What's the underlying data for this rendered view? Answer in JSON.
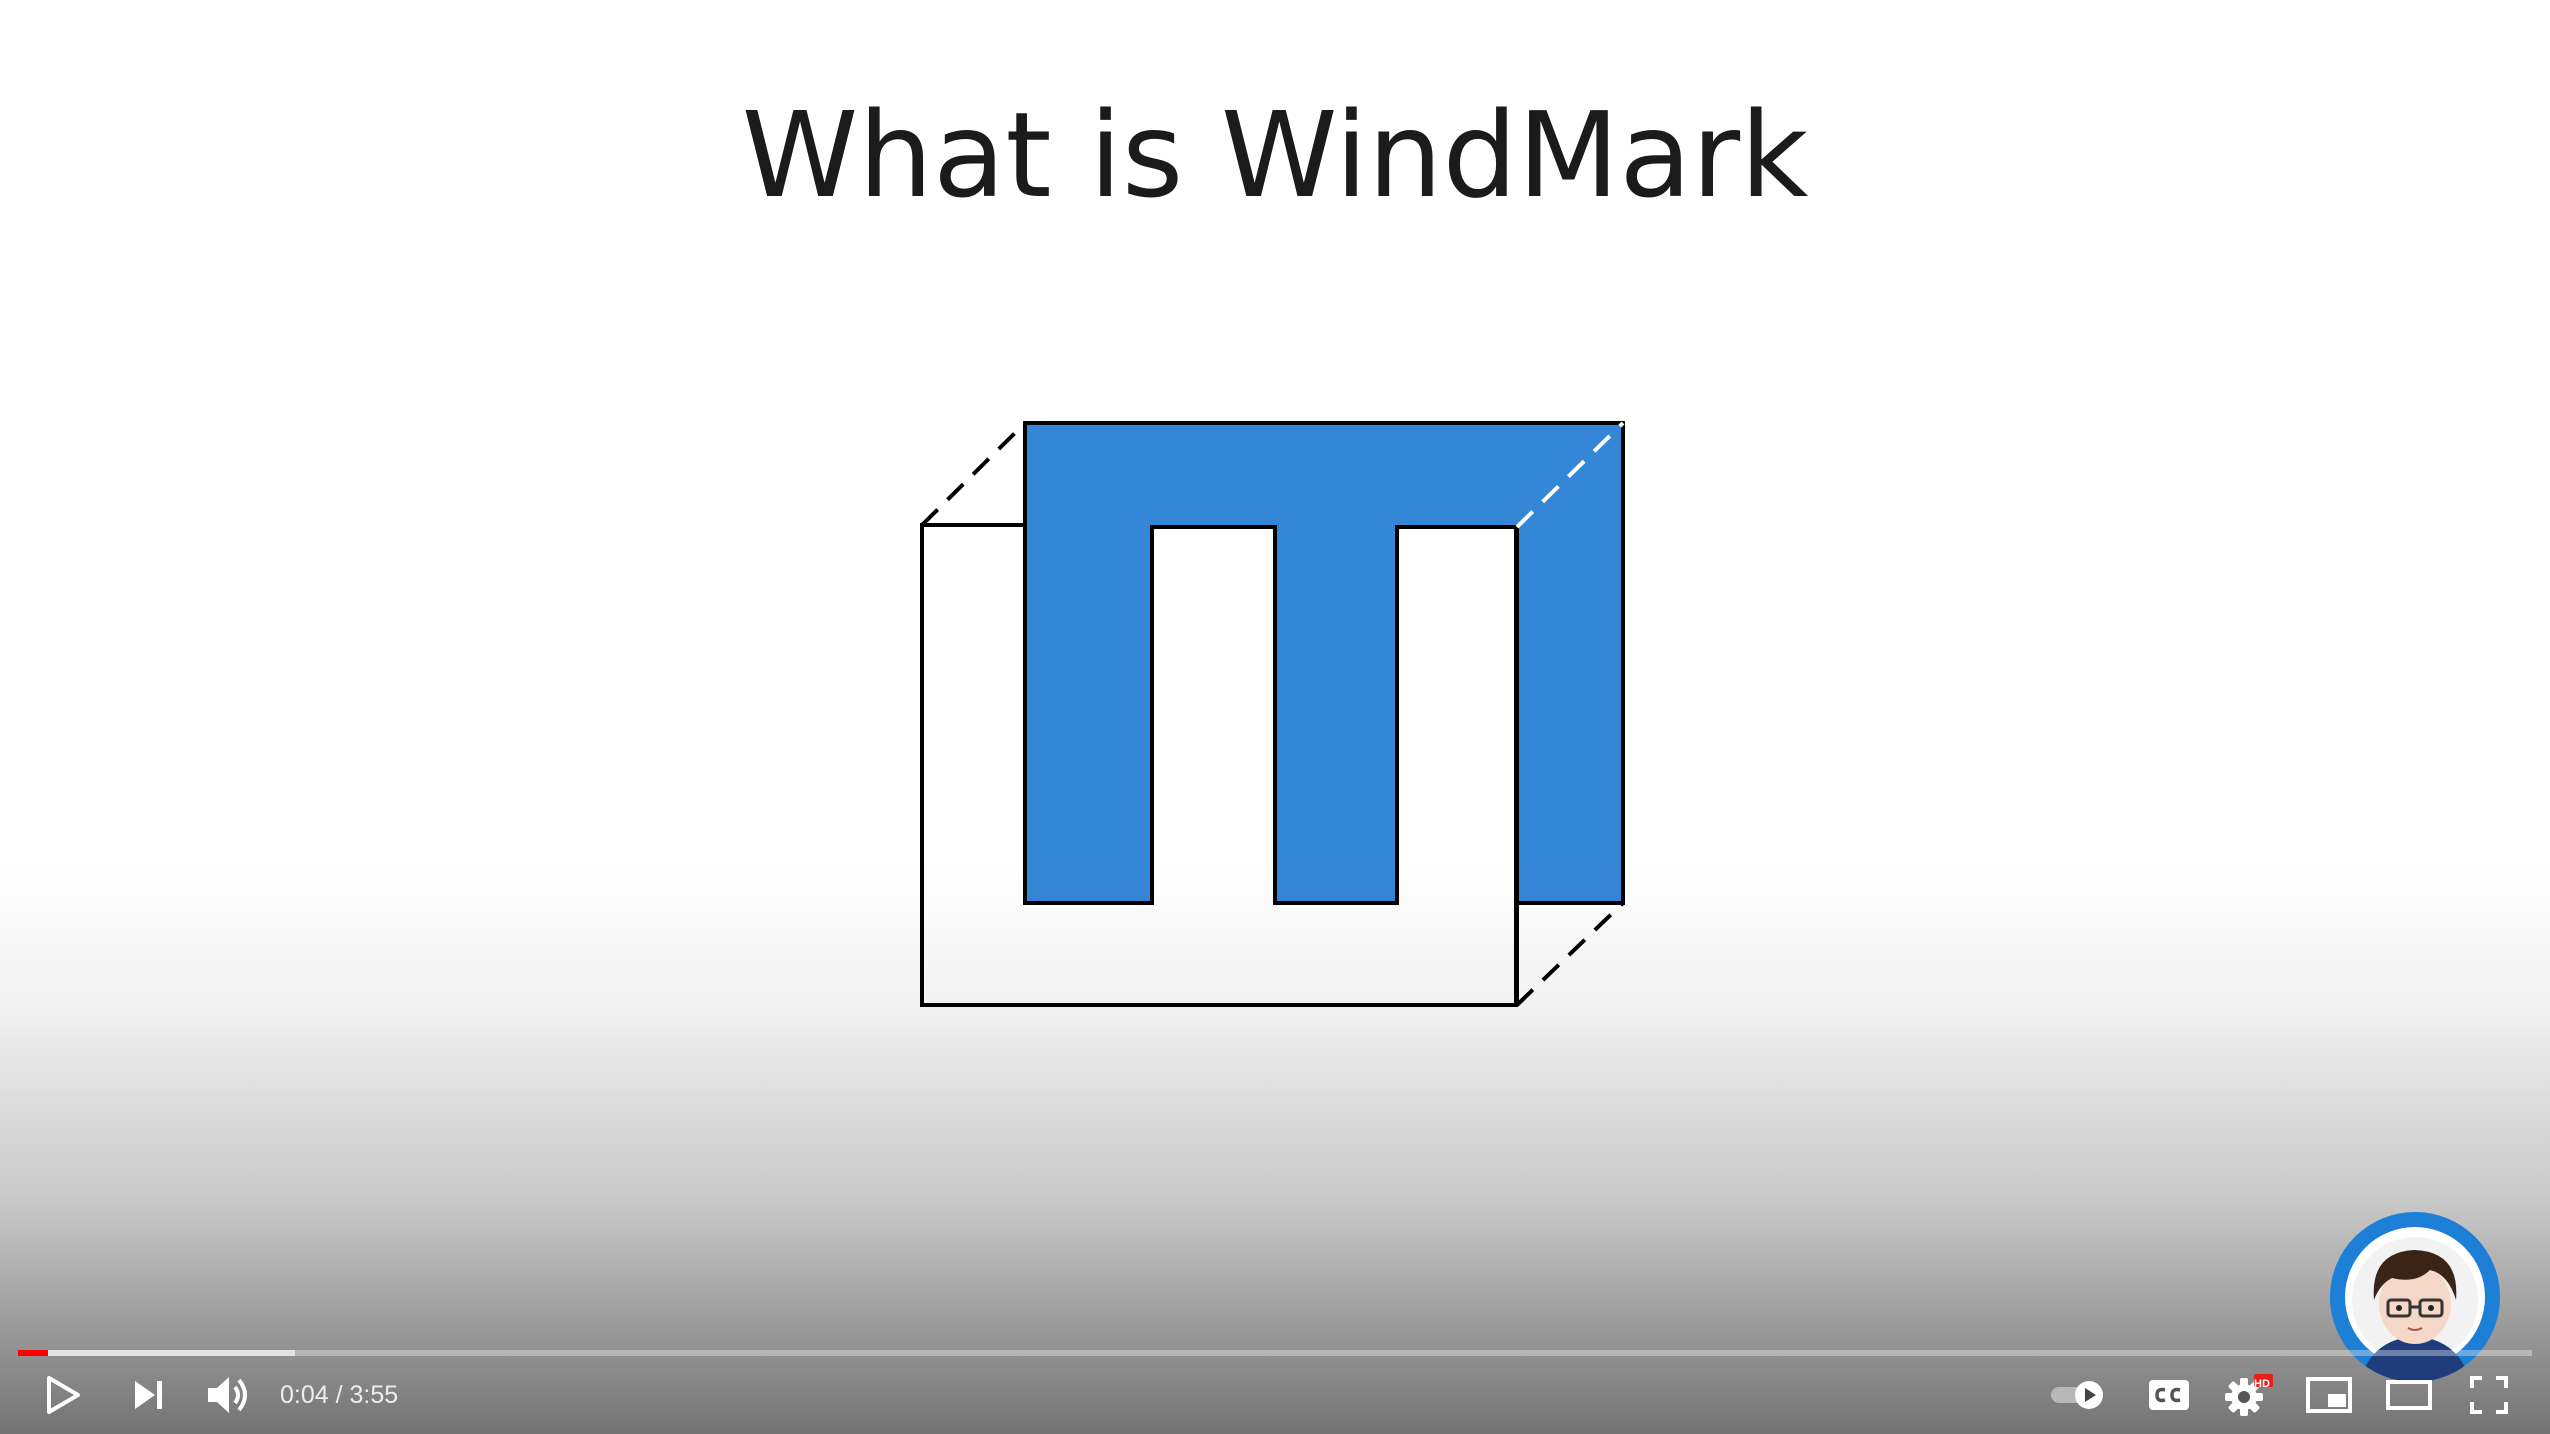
{
  "slide": {
    "title": "What is WindMark",
    "logo_colors": {
      "fill": "#3487d6",
      "outline": "#000000",
      "background": "#ffffff"
    }
  },
  "player": {
    "progress": {
      "played_fraction": 0.012,
      "buffered_fraction": 0.11,
      "played_color": "#ff0000"
    },
    "time": {
      "current": "0:04",
      "separator": " / ",
      "duration": "3:55"
    },
    "controls": {
      "left": [
        "play-icon",
        "next-icon",
        "volume-icon"
      ],
      "right": [
        "autoplay-toggle-icon",
        "subtitles-icon",
        "settings-icon",
        "miniplayer-icon",
        "theater-mode-icon",
        "fullscreen-icon"
      ]
    },
    "settings_badge": "HD",
    "watermark": {
      "icon": "channel-avatar-icon",
      "ring_color": "#1d7fd6"
    }
  }
}
